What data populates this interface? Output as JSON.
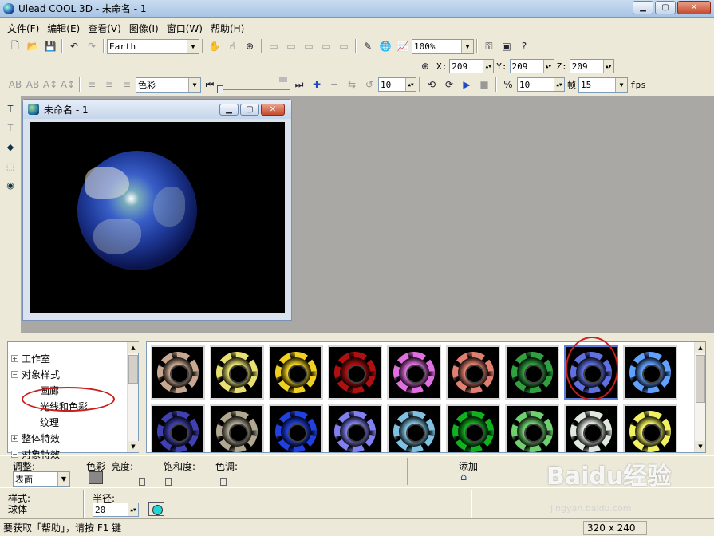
{
  "window": {
    "title": "Ulead COOL 3D - 未命名 - 1"
  },
  "menu": [
    "文件(F)",
    "编辑(E)",
    "查看(V)",
    "图像(I)",
    "窗口(W)",
    "帮助(H)"
  ],
  "toolbar1": {
    "font_value": "Earth",
    "zoom_value": "100%"
  },
  "toolbar2": {
    "x_label": "X:",
    "x_value": "209",
    "y_label": "Y:",
    "y_value": "209",
    "z_label": "Z:",
    "z_value": "209"
  },
  "toolbar3": {
    "color_mode": "色彩",
    "frame_value": "10",
    "speed_value": "10",
    "frame_label": "帧",
    "fps_value": "15",
    "fps_label": "fps"
  },
  "document": {
    "title": "未命名 - 1"
  },
  "tree": {
    "items": [
      {
        "label": "工作室",
        "toggle": "+"
      },
      {
        "label": "对象样式",
        "toggle": "−"
      },
      {
        "label": "画廊",
        "toggle": ""
      },
      {
        "label": "光线和色彩",
        "toggle": ""
      },
      {
        "label": "纹理",
        "toggle": ""
      },
      {
        "label": "整体特效",
        "toggle": "+"
      },
      {
        "label": "对象特效",
        "toggle": "−"
      }
    ]
  },
  "gallery": {
    "row1": [
      "#c8a890",
      "#e8e070",
      "#f0d020",
      "#b01010",
      "#e070e0",
      "#e08070",
      "#30a040",
      "#6070e0",
      "#60a0ff"
    ],
    "row2": [
      "#4040b0",
      "#b0a890",
      "#2040e0",
      "#8080f0",
      "#80c0e0",
      "#10b020",
      "#70d070",
      "#e0e8e0",
      "#f0f060"
    ],
    "selected_index": 7
  },
  "props": {
    "adjust_label": "调整:",
    "adjust_value": "表面",
    "color_label": "色彩",
    "brightness_label": "亮度:",
    "saturation_label": "饱和度:",
    "hue_label": "色调:",
    "add_label": "添加",
    "style_label": "样式:",
    "style_value": "球体",
    "radius_label": "半径:",
    "radius_value": "20"
  },
  "status": {
    "help": "要获取「帮助」，请按 F1 键",
    "size": "320 x 240"
  },
  "watermark": {
    "logo": "Baidu经验",
    "url": "jingyan.baidu.com"
  }
}
